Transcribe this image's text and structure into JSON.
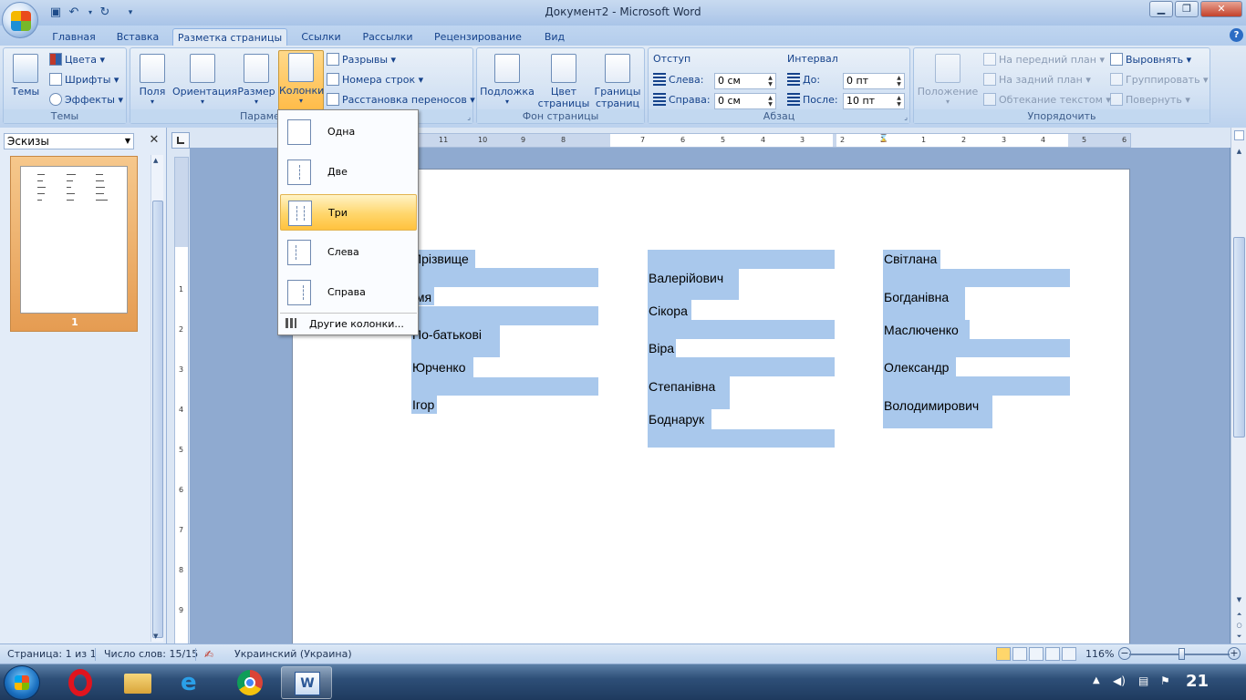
{
  "window": {
    "title": "Документ2 - Microsoft Word"
  },
  "tabs": [
    {
      "label": "Главная"
    },
    {
      "label": "Вставка"
    },
    {
      "label": "Разметка страницы",
      "active": true
    },
    {
      "label": "Ссылки"
    },
    {
      "label": "Рассылки"
    },
    {
      "label": "Рецензирование"
    },
    {
      "label": "Вид"
    }
  ],
  "ribbon": {
    "themes": {
      "label": "Темы",
      "btn": "Темы",
      "colors": "Цвета",
      "fonts": "Шрифты",
      "effects": "Эффекты"
    },
    "page_setup": {
      "label": "Парамет",
      "fields": "Поля",
      "orientation": "Ориентация",
      "size": "Размер",
      "columns": "Колонки",
      "breaks": "Разрывы",
      "line_numbers": "Номера строк",
      "hyphenation": "Расстановка переносов"
    },
    "background": {
      "label": "Фон страницы",
      "watermark": "Подложка",
      "page_color_1": "Цвет",
      "page_color_2": "страницы",
      "borders_1": "Границы",
      "borders_2": "страниц"
    },
    "paragraph": {
      "label": "Абзац",
      "indent": "Отступ",
      "left": "Слева:",
      "left_val": "0 см",
      "right": "Справа:",
      "right_val": "0 см",
      "spacing": "Интервал",
      "before": "До:",
      "before_val": "0 пт",
      "after": "После:",
      "after_val": "10 пт"
    },
    "arrange": {
      "label": "Упорядочить",
      "position": "Положение",
      "front": "На передний план",
      "back": "На задний план",
      "wrap": "Обтекание текстом",
      "align": "Выровнять",
      "group": "Группировать",
      "rotate": "Повернуть"
    }
  },
  "columns_menu": {
    "items": [
      "Одна",
      "Две",
      "Три",
      "Слева",
      "Справа"
    ],
    "hovered": "Три",
    "more": "Другие колонки..."
  },
  "left_pane": {
    "title": "Эскизы",
    "page_num": "1"
  },
  "document": {
    "col1": [
      "Прізвище",
      "Імя",
      "По-батькові",
      "Юрченко",
      "Ігор"
    ],
    "col2": [
      "Валерійович",
      "Сікора",
      "Віра",
      "Степанівна",
      "Боднарук"
    ],
    "col3": [
      "Світлана",
      "Богданівна",
      "Маслюченко",
      "Олександр",
      "Володимирович"
    ]
  },
  "ruler": {
    "numbers": [
      "11",
      "10",
      "9",
      "8",
      "7",
      "6",
      "5",
      "4",
      "3",
      "2",
      "1",
      "1",
      "2",
      "3",
      "4",
      "5",
      "6"
    ]
  },
  "status": {
    "page": "Страница: 1 из 1",
    "words": "Число слов: 15/15",
    "language": "Украинский (Украина)",
    "zoom": "116%"
  },
  "taskbar": {
    "time": "21"
  },
  "colors": {
    "selection": "#a9c8ec",
    "ribbon_bg": "#dfe9f5",
    "hover": "#ffd66b"
  }
}
